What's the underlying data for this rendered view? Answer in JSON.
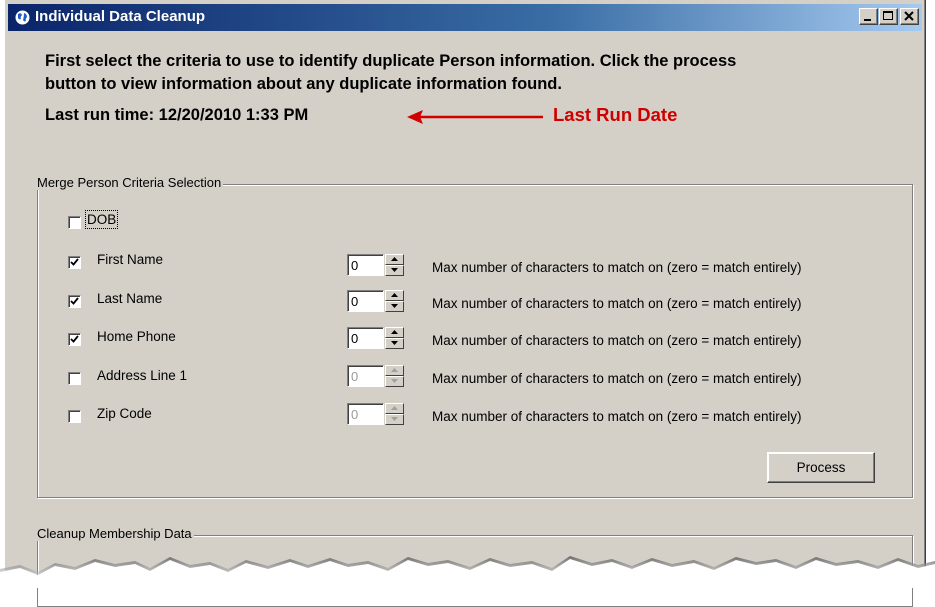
{
  "window": {
    "title": "Individual Data Cleanup"
  },
  "header": {
    "intro_line1": "First select the criteria to use to identify duplicate Person information. Click the process",
    "intro_line2": "button to view information about any duplicate information found.",
    "last_run": "Last run time: 12/20/2010 1:33 PM",
    "annotation": "Last Run Date"
  },
  "criteria": {
    "legend": "Merge Person Criteria Selection",
    "dob": {
      "label": "DOB",
      "checked": false
    },
    "rows": [
      {
        "label": "First Name",
        "checked": true,
        "value": "0",
        "enabled": true,
        "note": "Max number of characters to match on (zero = match entirely)"
      },
      {
        "label": "Last Name",
        "checked": true,
        "value": "0",
        "enabled": true,
        "note": "Max number of characters to match on (zero = match entirely)"
      },
      {
        "label": "Home Phone",
        "checked": true,
        "value": "0",
        "enabled": true,
        "note": "Max number of characters to match on (zero = match entirely)"
      },
      {
        "label": "Address Line 1",
        "checked": false,
        "value": "0",
        "enabled": false,
        "note": "Max number of characters to match on (zero = match entirely)"
      },
      {
        "label": "Zip Code",
        "checked": false,
        "value": "0",
        "enabled": false,
        "note": "Max number of characters to match on (zero = match entirely)"
      }
    ],
    "process_label": "Process"
  },
  "membership": {
    "legend": "Cleanup Membership Data"
  },
  "colors": {
    "annotation": "#d00000",
    "titlebar_start": "#0a246a",
    "titlebar_end": "#a6caf0",
    "face": "#d4d0c8"
  }
}
